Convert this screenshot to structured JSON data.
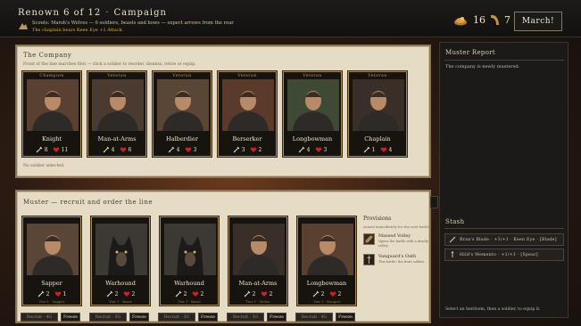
{
  "header": {
    "renown": "Renown 6 of 12",
    "separator": "·",
    "mode": "Campaign",
    "scouts": "Scouts: Marsh's Wolves — 6 soldiers, beasts and bows — expect arrows from the rear",
    "warning": "The chaplain bears Keen Eye +1 Attack.",
    "gold": "16",
    "horns": "7",
    "march_label": "March!"
  },
  "company": {
    "title": "The Company",
    "subtitle": "Front of the line marches first — click a soldier to reorder, dismiss, retire or equip.",
    "footer": "No soldier selected.",
    "units": [
      {
        "rank": "Champion",
        "name": "Knight",
        "attack": "8",
        "health": "11"
      },
      {
        "rank": "Veteran",
        "name": "Man-at-Arms",
        "attack": "4",
        "health": "6"
      },
      {
        "rank": "Veteran",
        "name": "Halberdier",
        "attack": "4",
        "health": "3"
      },
      {
        "rank": "Veteran",
        "name": "Berserker",
        "attack": "3",
        "health": "2"
      },
      {
        "rank": "Veteran",
        "name": "Longbowman",
        "attack": "4",
        "health": "3"
      },
      {
        "rank": "Veteran",
        "name": "Chaplain",
        "attack": "1",
        "health": "4"
      }
    ]
  },
  "muster": {
    "title": "Muster — recruit and order the line",
    "recruits": [
      {
        "name": "Sapper",
        "attack": "2",
        "health": "1",
        "tier": "Tier 1 · Sapper",
        "cost": "Recruit · 4G",
        "freeze": "Freeze"
      },
      {
        "name": "Warhound",
        "attack": "2",
        "health": "2",
        "tier": "Tier 1 · Beast",
        "cost": "Recruit · 3G",
        "freeze": "Freeze"
      },
      {
        "name": "Warhound",
        "attack": "2",
        "health": "2",
        "tier": "Tier 1 · Beast",
        "cost": "Recruit · 3G",
        "freeze": "Freeze"
      },
      {
        "name": "Man-at-Arms",
        "attack": "2",
        "health": "2",
        "tier": "Tier 1 · Melee",
        "cost": "Recruit · 3G",
        "freeze": "Freeze"
      },
      {
        "name": "Longbowman",
        "attack": "2",
        "health": "2",
        "tier": "Tier 2 · Ranged",
        "cost": "Recruit · 4G",
        "freeze": "Freeze"
      }
    ],
    "provisions": {
      "title": "Provisions",
      "subtitle": "Armed immediately for the next battle.",
      "items": [
        {
          "name": "Massed Volley",
          "desc": "Opens the battle with a deadly volley."
        },
        {
          "name": "Vanguard's Oath",
          "desc": "This battle: the front soldier"
        }
      ]
    }
  },
  "sidebar": {
    "report_title": "Muster Report",
    "report_text": "The company is newly mustered.",
    "stash_title": "Stash",
    "stash": [
      {
        "label": "Bran's Blade · +3/+1 · Keen Eye · [Blade]"
      },
      {
        "label": "Hild's Memento · +1/+1 · [Spear]"
      }
    ],
    "hint": "Select an heirloom, then a soldier, to equip it."
  },
  "colors": {
    "accent": "#a98a56",
    "parchment": "#e6dcc6",
    "health": "#c2262a",
    "gold": "#e0b03e"
  }
}
